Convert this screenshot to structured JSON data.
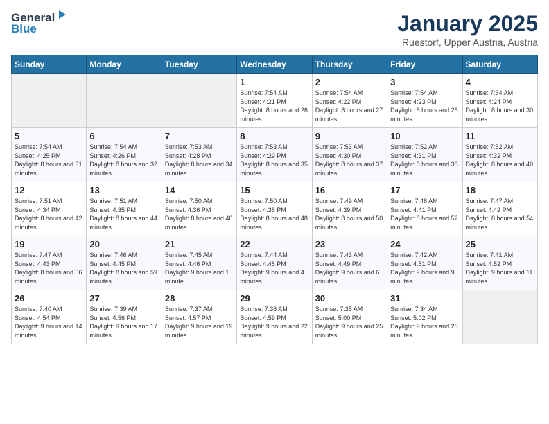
{
  "header": {
    "logo_general": "General",
    "logo_blue": "Blue",
    "title": "January 2025",
    "subtitle": "Ruestorf, Upper Austria, Austria"
  },
  "weekdays": [
    "Sunday",
    "Monday",
    "Tuesday",
    "Wednesday",
    "Thursday",
    "Friday",
    "Saturday"
  ],
  "weeks": [
    [
      {
        "day": "",
        "info": ""
      },
      {
        "day": "",
        "info": ""
      },
      {
        "day": "",
        "info": ""
      },
      {
        "day": "1",
        "info": "Sunrise: 7:54 AM\nSunset: 4:21 PM\nDaylight: 8 hours and 26 minutes."
      },
      {
        "day": "2",
        "info": "Sunrise: 7:54 AM\nSunset: 4:22 PM\nDaylight: 8 hours and 27 minutes."
      },
      {
        "day": "3",
        "info": "Sunrise: 7:54 AM\nSunset: 4:23 PM\nDaylight: 8 hours and 28 minutes."
      },
      {
        "day": "4",
        "info": "Sunrise: 7:54 AM\nSunset: 4:24 PM\nDaylight: 8 hours and 30 minutes."
      }
    ],
    [
      {
        "day": "5",
        "info": "Sunrise: 7:54 AM\nSunset: 4:25 PM\nDaylight: 8 hours and 31 minutes."
      },
      {
        "day": "6",
        "info": "Sunrise: 7:54 AM\nSunset: 4:26 PM\nDaylight: 8 hours and 32 minutes."
      },
      {
        "day": "7",
        "info": "Sunrise: 7:53 AM\nSunset: 4:28 PM\nDaylight: 8 hours and 34 minutes."
      },
      {
        "day": "8",
        "info": "Sunrise: 7:53 AM\nSunset: 4:29 PM\nDaylight: 8 hours and 35 minutes."
      },
      {
        "day": "9",
        "info": "Sunrise: 7:53 AM\nSunset: 4:30 PM\nDaylight: 8 hours and 37 minutes."
      },
      {
        "day": "10",
        "info": "Sunrise: 7:52 AM\nSunset: 4:31 PM\nDaylight: 8 hours and 38 minutes."
      },
      {
        "day": "11",
        "info": "Sunrise: 7:52 AM\nSunset: 4:32 PM\nDaylight: 8 hours and 40 minutes."
      }
    ],
    [
      {
        "day": "12",
        "info": "Sunrise: 7:51 AM\nSunset: 4:34 PM\nDaylight: 8 hours and 42 minutes."
      },
      {
        "day": "13",
        "info": "Sunrise: 7:51 AM\nSunset: 4:35 PM\nDaylight: 8 hours and 44 minutes."
      },
      {
        "day": "14",
        "info": "Sunrise: 7:50 AM\nSunset: 4:36 PM\nDaylight: 8 hours and 46 minutes."
      },
      {
        "day": "15",
        "info": "Sunrise: 7:50 AM\nSunset: 4:38 PM\nDaylight: 8 hours and 48 minutes."
      },
      {
        "day": "16",
        "info": "Sunrise: 7:49 AM\nSunset: 4:39 PM\nDaylight: 8 hours and 50 minutes."
      },
      {
        "day": "17",
        "info": "Sunrise: 7:48 AM\nSunset: 4:41 PM\nDaylight: 8 hours and 52 minutes."
      },
      {
        "day": "18",
        "info": "Sunrise: 7:47 AM\nSunset: 4:42 PM\nDaylight: 8 hours and 54 minutes."
      }
    ],
    [
      {
        "day": "19",
        "info": "Sunrise: 7:47 AM\nSunset: 4:43 PM\nDaylight: 8 hours and 56 minutes."
      },
      {
        "day": "20",
        "info": "Sunrise: 7:46 AM\nSunset: 4:45 PM\nDaylight: 8 hours and 59 minutes."
      },
      {
        "day": "21",
        "info": "Sunrise: 7:45 AM\nSunset: 4:46 PM\nDaylight: 9 hours and 1 minute."
      },
      {
        "day": "22",
        "info": "Sunrise: 7:44 AM\nSunset: 4:48 PM\nDaylight: 9 hours and 4 minutes."
      },
      {
        "day": "23",
        "info": "Sunrise: 7:43 AM\nSunset: 4:49 PM\nDaylight: 9 hours and 6 minutes."
      },
      {
        "day": "24",
        "info": "Sunrise: 7:42 AM\nSunset: 4:51 PM\nDaylight: 9 hours and 9 minutes."
      },
      {
        "day": "25",
        "info": "Sunrise: 7:41 AM\nSunset: 4:52 PM\nDaylight: 9 hours and 11 minutes."
      }
    ],
    [
      {
        "day": "26",
        "info": "Sunrise: 7:40 AM\nSunset: 4:54 PM\nDaylight: 9 hours and 14 minutes."
      },
      {
        "day": "27",
        "info": "Sunrise: 7:39 AM\nSunset: 4:56 PM\nDaylight: 9 hours and 17 minutes."
      },
      {
        "day": "28",
        "info": "Sunrise: 7:37 AM\nSunset: 4:57 PM\nDaylight: 9 hours and 19 minutes."
      },
      {
        "day": "29",
        "info": "Sunrise: 7:36 AM\nSunset: 4:59 PM\nDaylight: 9 hours and 22 minutes."
      },
      {
        "day": "30",
        "info": "Sunrise: 7:35 AM\nSunset: 5:00 PM\nDaylight: 9 hours and 25 minutes."
      },
      {
        "day": "31",
        "info": "Sunrise: 7:34 AM\nSunset: 5:02 PM\nDaylight: 9 hours and 28 minutes."
      },
      {
        "day": "",
        "info": ""
      }
    ]
  ]
}
